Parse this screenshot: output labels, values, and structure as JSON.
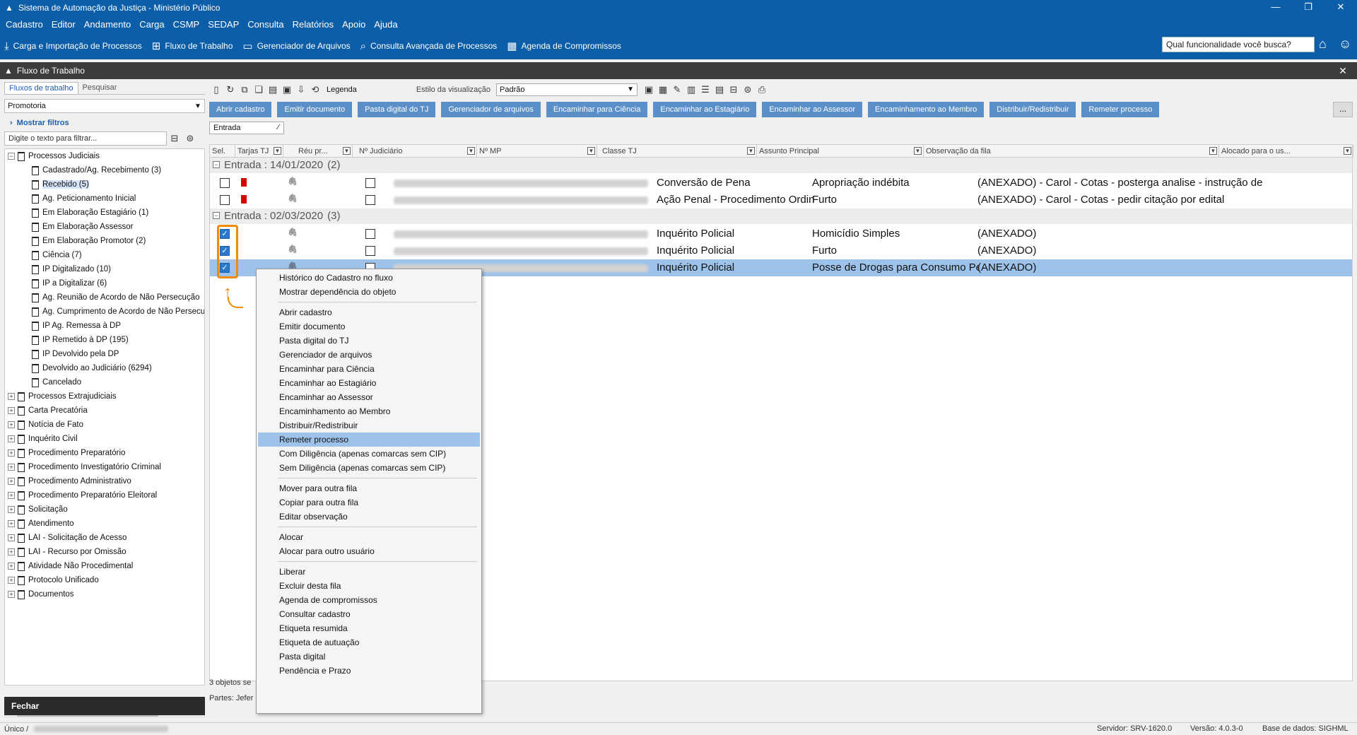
{
  "window": {
    "title": "Sistema de Automação da Justiça - Ministério Público"
  },
  "menu": [
    "Cadastro",
    "Editor",
    "Andamento",
    "Carga",
    "CSMP",
    "SEDAP",
    "Consulta",
    "Relatórios",
    "Apoio",
    "Ajuda"
  ],
  "toolbar": {
    "items": [
      {
        "label": "Carga e Importação de Processos",
        "icon": "download-icon"
      },
      {
        "label": "Fluxo de Trabalho",
        "icon": "workflow-icon"
      },
      {
        "label": "Gerenciador de Arquivos",
        "icon": "folder-icon"
      },
      {
        "label": "Consulta Avançada de Processos",
        "icon": "search-icon"
      },
      {
        "label": "Agenda de Compromissos",
        "icon": "calendar-icon"
      }
    ],
    "search_placeholder": "Qual funcionalidade você busca?"
  },
  "panel": {
    "title": "Fluxo de Trabalho"
  },
  "left": {
    "tabs": [
      "Fluxos de trabalho",
      "Pesquisar"
    ],
    "combo": "Promotoria",
    "show_filters": "Mostrar filtros",
    "filter_placeholder": "Digite o texto para filtrar...",
    "tree": [
      {
        "label": "Processos Judiciais",
        "level": 0,
        "expander": "−"
      },
      {
        "label": "Cadastrado/Ag. Recebimento (3)",
        "level": 1
      },
      {
        "label": "Recebido (5)",
        "level": 1,
        "selected": true
      },
      {
        "label": "Ag. Peticionamento Inicial",
        "level": 1
      },
      {
        "label": "Em Elaboração Estagiário (1)",
        "level": 1
      },
      {
        "label": "Em Elaboração Assessor",
        "level": 1
      },
      {
        "label": "Em Elaboração Promotor (2)",
        "level": 1
      },
      {
        "label": "Ciência (7)",
        "level": 1
      },
      {
        "label": "IP Digitalizado (10)",
        "level": 1
      },
      {
        "label": "IP a Digitalizar (6)",
        "level": 1
      },
      {
        "label": "Ag. Reunião de Acordo de Não Persecução",
        "level": 1
      },
      {
        "label": "Ag. Cumprimento de Acordo de Não Persecução",
        "level": 1
      },
      {
        "label": "IP Ag. Remessa à DP",
        "level": 1
      },
      {
        "label": "IP Remetido à DP (195)",
        "level": 1
      },
      {
        "label": "IP Devolvido pela DP",
        "level": 1
      },
      {
        "label": "Devolvido ao Judiciário (6294)",
        "level": 1
      },
      {
        "label": "Cancelado",
        "level": 1
      },
      {
        "label": "Processos Extrajudiciais",
        "level": 0,
        "expander": "+"
      },
      {
        "label": "Carta Precatória",
        "level": 0,
        "expander": "+"
      },
      {
        "label": "Notícia de Fato",
        "level": 0,
        "expander": "+"
      },
      {
        "label": "Inquérito Civil",
        "level": 0,
        "expander": "+"
      },
      {
        "label": "Procedimento Preparatório",
        "level": 0,
        "expander": "+"
      },
      {
        "label": "Procedimento Investigatório Criminal",
        "level": 0,
        "expander": "+"
      },
      {
        "label": "Procedimento Administrativo",
        "level": 0,
        "expander": "+"
      },
      {
        "label": "Procedimento Preparatório Eleitoral",
        "level": 0,
        "expander": "+"
      },
      {
        "label": "Solicitação",
        "level": 0,
        "expander": "+"
      },
      {
        "label": "Atendimento",
        "level": 0,
        "expander": "+"
      },
      {
        "label": "LAI - Solicitação de Acesso",
        "level": 0,
        "expander": "+"
      },
      {
        "label": "LAI - Recurso por Omissão",
        "level": 0,
        "expander": "+"
      },
      {
        "label": "Atividade Não Procedimental",
        "level": 0,
        "expander": "+"
      },
      {
        "label": "Protocolo Unificado",
        "level": 0,
        "expander": "+"
      },
      {
        "label": "Documentos",
        "level": 0,
        "expander": "+"
      }
    ],
    "close": "Fechar"
  },
  "main": {
    "legend": "Legenda",
    "style_label": "Estilo da visualização",
    "style_value": "Padrão",
    "actions": [
      "Abrir cadastro",
      "Emitir documento",
      "Pasta digital do TJ",
      "Gerenciador de arquivos",
      "Encaminhar para Ciência",
      "Encaminhar ao Estagiário",
      "Encaminhar ao Assessor",
      "Encaminhamento ao Membro",
      "Distribuir/Redistribuir",
      "Remeter processo"
    ],
    "more": "...",
    "group_box": "Entrada",
    "columns": [
      "Sel.",
      "Tarjas TJ",
      "Réu pr...",
      "Nº Judiciário",
      "Nº MP",
      "Classe TJ",
      "Assunto Principal",
      "Observação da fila",
      "Alocado para o us..."
    ],
    "groups": [
      {
        "label": "Entrada : 14/01/2020",
        "count": "(2)",
        "rows": [
          {
            "checked": false,
            "flag": true,
            "classe": "Conversão de Pena",
            "assunto": "Apropriação indébita",
            "obs": "(ANEXADO) - Carol - Cotas - posterga analise - instrução de"
          },
          {
            "checked": false,
            "flag": true,
            "classe": "Ação Penal - Procedimento Ordinário",
            "assunto": "Furto",
            "obs": "(ANEXADO) - Carol - Cotas - pedir citação por edital"
          }
        ]
      },
      {
        "label": "Entrada : 02/03/2020",
        "count": "(3)",
        "rows": [
          {
            "checked": true,
            "flag": false,
            "classe": "Inquérito Policial",
            "assunto": "Homicídio Simples",
            "obs": "(ANEXADO)"
          },
          {
            "checked": true,
            "flag": false,
            "classe": "Inquérito Policial",
            "assunto": "Furto",
            "obs": "(ANEXADO)"
          },
          {
            "checked": true,
            "flag": false,
            "classe": "Inquérito Policial",
            "assunto": "Posse de Drogas para Consumo Pessoal",
            "obs": "(ANEXADO)",
            "selected": true
          }
        ]
      }
    ],
    "status": "3 objetos se",
    "partes": "Partes: Jefer"
  },
  "context_menu": [
    {
      "label": "Histórico do Cadastro no fluxo"
    },
    {
      "label": "Mostrar dependência do objeto"
    },
    {
      "sep": true
    },
    {
      "label": "Abrir cadastro"
    },
    {
      "label": "Emitir documento"
    },
    {
      "label": "Pasta digital do TJ"
    },
    {
      "label": "Gerenciador de arquivos"
    },
    {
      "label": "Encaminhar para Ciência"
    },
    {
      "label": "Encaminhar ao Estagiário"
    },
    {
      "label": "Encaminhar ao Assessor"
    },
    {
      "label": "Encaminhamento ao Membro"
    },
    {
      "label": "Distribuir/Redistribuir"
    },
    {
      "label": "Remeter processo",
      "hover": true
    },
    {
      "label": "Com Diligência (apenas comarcas sem CIP)"
    },
    {
      "label": "Sem Diligência (apenas comarcas sem CIP)"
    },
    {
      "sep": true
    },
    {
      "label": "Mover para outra fila"
    },
    {
      "label": "Copiar para outra fila"
    },
    {
      "label": "Editar observação"
    },
    {
      "sep": true
    },
    {
      "label": "Alocar"
    },
    {
      "label": "Alocar para outro usuário"
    },
    {
      "sep": true
    },
    {
      "label": "Liberar"
    },
    {
      "label": "Excluir desta fila"
    },
    {
      "label": "Agenda de compromissos"
    },
    {
      "label": "Consultar cadastro"
    },
    {
      "label": "Etiqueta resumida"
    },
    {
      "label": "Etiqueta de autuação"
    },
    {
      "label": "Pasta digital"
    },
    {
      "label": "Pendência e Prazo"
    }
  ],
  "status_bar": {
    "left": "Único /",
    "server": "Servidor: SRV-1620.0",
    "version": "Versão: 4.0.3-0",
    "database": "Base de dados: SIGHML"
  },
  "colors": {
    "brand": "#0d5ea8",
    "action_button": "#5a8fc9",
    "selection": "#9dc3ea",
    "highlight": "#f08a00"
  }
}
